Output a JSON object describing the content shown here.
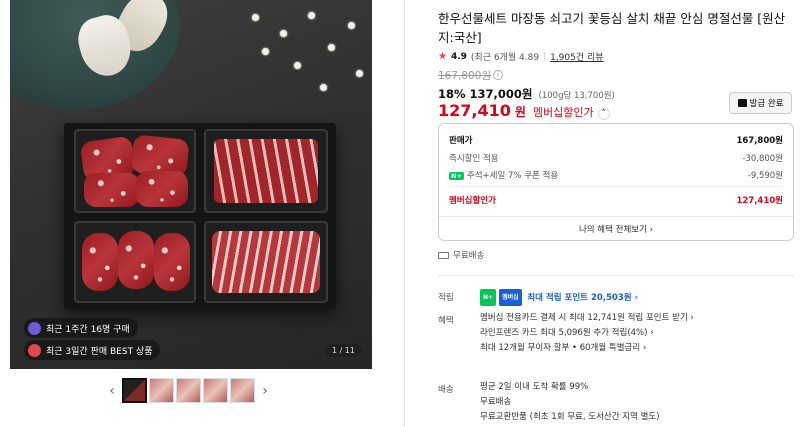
{
  "gallery": {
    "pill_recent": "최근 1주간 16명 구매",
    "pill_best": "최근 3일간 판매 BEST 상품",
    "counter": "1 / 11",
    "prev_label": "‹",
    "next_label": "›"
  },
  "product": {
    "title": "한우선물세트 마장동 쇠고기 꽃등심 살치 채끝 안심 명절선물 [원산지:국산]",
    "rating": "4.9",
    "rating_recent": "(최근 6개월 4.89",
    "reviews": "1,905건 리뷰",
    "original_price": "167,800원",
    "discount_rate": "18%",
    "sale_price": "137,000원",
    "unit_price": "(100g당 13,700원)",
    "member_price": "127,410",
    "member_won": "원",
    "member_label": "멤버십할인가",
    "coupon_button": "발급 완료"
  },
  "breakdown": {
    "rows": [
      {
        "label": "판매가",
        "value": "167,800원"
      },
      {
        "label": "즉시할인 적용",
        "value": "-30,800원"
      },
      {
        "label": "주석+세일 7% 쿠폰 적용",
        "value": "-9,590원"
      }
    ],
    "npay_mark": "N+",
    "total_label": "멤버십할인가",
    "total_value": "127,410원",
    "link": "나의 혜택 전체보기 ›"
  },
  "shipping_free": "무료배송",
  "points": {
    "label": "적립",
    "badge": "N+",
    "badge2": "멤버십",
    "text": "최대 적립 포인트 20,503원 ›"
  },
  "benefits": {
    "label": "혜택",
    "lines": [
      "멤버십 전용카드 결제 시 최대 12,741원 적립 포인트 받기 ›",
      "라인프렌즈 카드 최대 5,096원 추가 적립(4%) ›",
      "최대 12개월 무이자 할부 • 60개월 특별금리 ›"
    ]
  },
  "delivery": {
    "label": "배송",
    "lines": [
      "평균 2일 이내 도착 확률 99%",
      "무료배송",
      "무료교환반품 (최초 1회 무료, 도서산간 지역 별도)"
    ]
  },
  "colors": {
    "accent_red": "#e1001a",
    "npay_green": "#03c75a",
    "point_blue": "#1a5fd8"
  }
}
